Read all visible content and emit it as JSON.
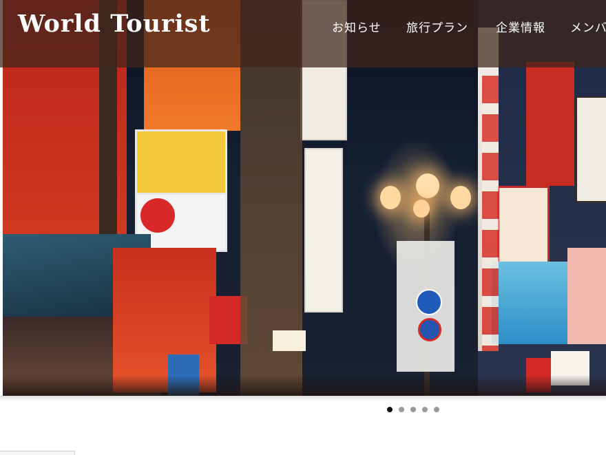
{
  "header": {
    "logo": "World Tourist"
  },
  "nav": {
    "items": [
      {
        "label": "お知らせ"
      },
      {
        "label": "旅行プラン"
      },
      {
        "label": "企業情報"
      },
      {
        "label": "メンバー"
      }
    ]
  },
  "hero": {
    "slides_count": 5,
    "active_slide": 1
  },
  "colors": {
    "header_overlay": "#40261c",
    "dot_active": "#111111",
    "dot_inactive": "#9a9a9a"
  }
}
